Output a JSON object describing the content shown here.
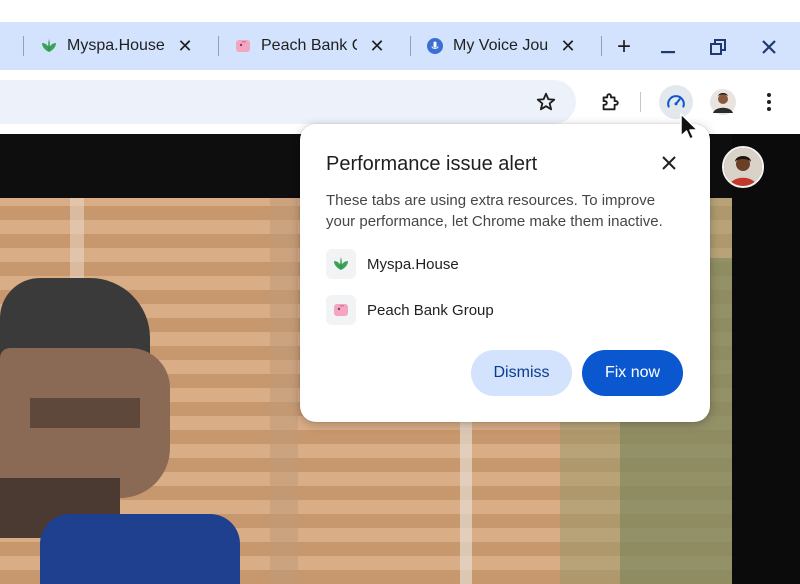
{
  "tabs": [
    {
      "title": "Myspa.House",
      "favicon": "leaf-icon",
      "close": "✕"
    },
    {
      "title": "Peach Bank Gr",
      "favicon": "piggy-bank-icon",
      "close": "✕"
    },
    {
      "title": "My Voice Jour",
      "favicon": "microphone-icon",
      "close": "✕"
    }
  ],
  "tabstrip": {
    "new_tab": "+"
  },
  "window_controls": {
    "minimize": "minimize-icon",
    "restore": "restore-icon",
    "close": "close-icon"
  },
  "toolbar": {
    "bookmark": "star-icon",
    "extensions": "puzzle-icon",
    "performance": "speedometer-icon",
    "profile": "profile-avatar",
    "menu": "three-dot-menu-icon"
  },
  "popup": {
    "title": "Performance issue alert",
    "body": "These tabs are using extra resources. To improve your performance, let Chrome make them inactive.",
    "sites": [
      {
        "name": "Myspa.House",
        "favicon": "leaf-icon"
      },
      {
        "name": "Peach Bank Group",
        "favicon": "piggy-bank-icon"
      }
    ],
    "dismiss_label": "Dismiss",
    "fix_label": "Fix now"
  },
  "colors": {
    "tabstrip": "#d3e3fd",
    "omnibox": "#edf2fa",
    "primary": "#0b57d0",
    "tonal": "#d3e3fd",
    "leaf": "#3aa357",
    "piggy": "#f4a6c1",
    "mic": "#3b6fd4"
  }
}
